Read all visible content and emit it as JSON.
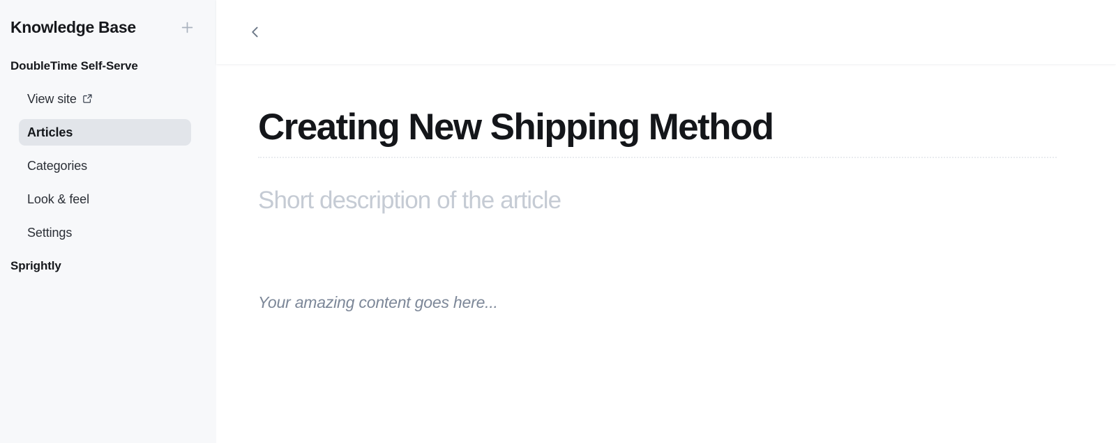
{
  "sidebar": {
    "title": "Knowledge Base",
    "add_button": {
      "label": "+",
      "icon": "plus-icon",
      "color": "#a9b2be"
    },
    "groups": [
      {
        "label": "DoubleTime Self-Serve",
        "items": [
          {
            "label": "View site",
            "icon": "external-link-icon",
            "active": false
          },
          {
            "label": "Articles",
            "icon": null,
            "active": true
          },
          {
            "label": "Categories",
            "icon": null,
            "active": false
          },
          {
            "label": "Look & feel",
            "icon": null,
            "active": false
          },
          {
            "label": "Settings",
            "icon": null,
            "active": false
          }
        ]
      },
      {
        "label": "Sprightly",
        "items": []
      }
    ]
  },
  "topbar": {
    "back_button": {
      "label": "Back",
      "icon": "chevron-left-icon",
      "color": "#6b7787"
    }
  },
  "editor": {
    "title": "Creating New Shipping Method",
    "title_placeholder": "Article title",
    "subtitle": "",
    "subtitle_placeholder": "Short description of the article",
    "body": "",
    "body_placeholder": "Your amazing content goes here..."
  },
  "colors": {
    "sidebar_bg": "#f7f8fa",
    "active_item_bg": "#e2e5ea",
    "main_bg": "#ffffff",
    "title_text": "#14161a",
    "placeholder_subtitle": "#c5cbd4",
    "placeholder_body": "#7c8798",
    "divider_dotted": "#e9ebef"
  }
}
